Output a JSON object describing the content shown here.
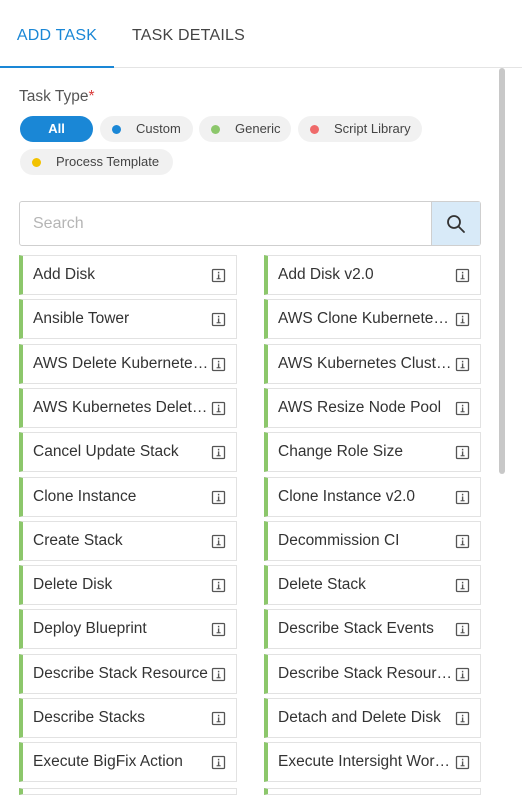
{
  "tabs": {
    "add_task": "ADD TASK",
    "task_details": "TASK DETAILS"
  },
  "task_type": {
    "label": "Task Type",
    "required_mark": "*",
    "filters": [
      {
        "label": "All",
        "selected": true
      },
      {
        "label": "Custom",
        "color": "#1a87d6"
      },
      {
        "label": "Generic",
        "color": "#8cc76b"
      },
      {
        "label": "Script Library",
        "color": "#ef6a6a"
      },
      {
        "label": "Process Template",
        "color": "#f2c200"
      }
    ]
  },
  "search": {
    "placeholder": "Search",
    "icon": "search-icon"
  },
  "tasks": [
    "Add Disk",
    "Add Disk v2.0",
    "Ansible Tower",
    "AWS Clone Kubernetes Cluster",
    "AWS Delete Kubernetes Cluster",
    "AWS Kubernetes Cluster Details",
    "AWS Kubernetes Delete Node Pool",
    "AWS Resize Node Pool",
    "Cancel Update Stack",
    "Change Role Size",
    "Clone Instance",
    "Clone Instance v2.0",
    "Create Stack",
    "Decommission CI",
    "Delete Disk",
    "Delete Stack",
    "Deploy Blueprint",
    "Describe Stack Events",
    "Describe Stack Resource",
    "Describe Stack Resources",
    "Describe Stacks",
    "Detach and Delete Disk",
    "Execute BigFix Action",
    "Execute Intersight Workflow"
  ],
  "colors": {
    "accent": "#1a87d6",
    "generic_bar": "#8cc76b",
    "search_button_bg": "#d8eaf8"
  }
}
